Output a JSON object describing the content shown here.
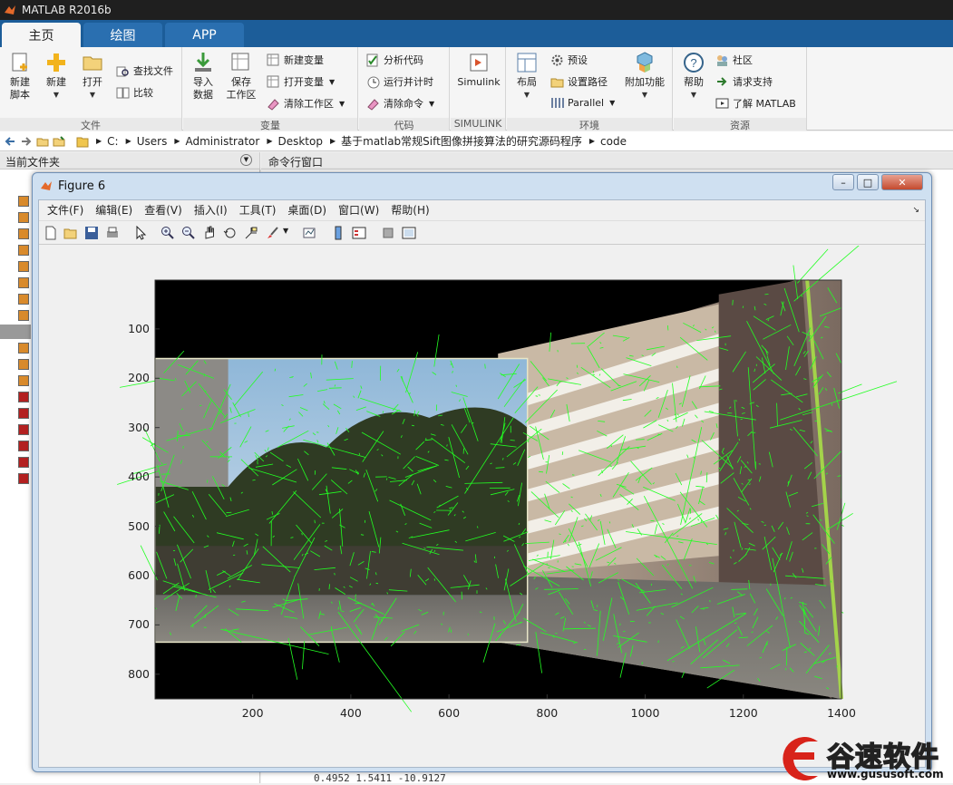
{
  "app": {
    "title": "MATLAB R2016b"
  },
  "tabs": [
    {
      "label": "主页",
      "active": true
    },
    {
      "label": "绘图",
      "active": false
    },
    {
      "label": "APP",
      "active": false
    }
  ],
  "ribbon": {
    "file": {
      "group_label": "文件",
      "new_script": "新建\n脚本",
      "new": "新建",
      "open": "打开",
      "find_files": "查找文件",
      "compare": "比较"
    },
    "variable": {
      "group_label": "变量",
      "import_data": "导入\n数据",
      "save_workspace": "保存\n工作区",
      "new_variable": "新建变量",
      "open_variable": "打开变量",
      "clear_workspace": "清除工作区"
    },
    "code": {
      "group_label": "代码",
      "analyze_code": "分析代码",
      "run_and_time": "运行并计时",
      "clear_commands": "清除命令"
    },
    "simulink": {
      "group_label": "SIMULINK",
      "simulink": "Simulink"
    },
    "environment": {
      "group_label": "环境",
      "layout": "布局",
      "preferences": "预设",
      "set_path": "设置路径",
      "parallel": "Parallel",
      "addons": "附加功能"
    },
    "resources": {
      "group_label": "资源",
      "help": "帮助",
      "community": "社区",
      "request_support": "请求支持",
      "learn_matlab": "了解 MATLAB"
    }
  },
  "address": {
    "crumbs": [
      "C:",
      "Users",
      "Administrator",
      "Desktop",
      "基于matlab常规Sift图像拼接算法的研究源码程序",
      "code"
    ]
  },
  "panels": {
    "current_folder": "当前文件夹",
    "command_window": "命令行窗口",
    "command_tail": "0.4952     1.5411   -10.9127"
  },
  "figure": {
    "title": "Figure 6",
    "menu": [
      "文件(F)",
      "编辑(E)",
      "查看(V)",
      "插入(I)",
      "工具(T)",
      "桌面(D)",
      "窗口(W)",
      "帮助(H)"
    ],
    "axes": {
      "x_ticks": [
        "200",
        "400",
        "600",
        "800",
        "1000",
        "1200",
        "1400"
      ],
      "y_ticks": [
        "100",
        "200",
        "300",
        "400",
        "500",
        "600",
        "700",
        "800"
      ]
    }
  },
  "watermark": {
    "name": "谷速软件",
    "url": "www.gususoft.com"
  },
  "colors": {
    "tab_bar": "#1c5d99",
    "keypoint": "#22ff22",
    "figure_frame": "#cfe0f1"
  }
}
